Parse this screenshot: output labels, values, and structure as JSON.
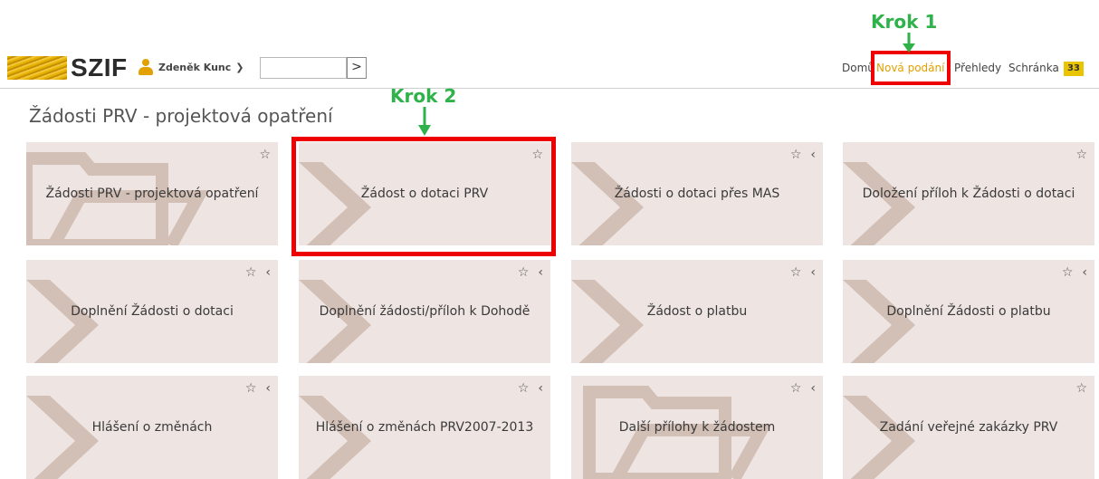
{
  "header": {
    "logo_text": "SZIF",
    "user_name": "Zdeněk Kunc",
    "search_value": "",
    "search_button": ">",
    "nav": [
      {
        "label": "Domů",
        "active": false
      },
      {
        "label": "Nová podání",
        "active": true
      },
      {
        "label": "Přehledy",
        "active": false
      },
      {
        "label": "Schránka",
        "active": false
      }
    ],
    "inbox_count": "33"
  },
  "annotations": {
    "step1": "Krok 1",
    "step2": "Krok 2"
  },
  "page": {
    "title": "Žádosti PRV - projektová opatření"
  },
  "tiles": [
    {
      "label": "Žádosti PRV - projektová opatření",
      "icon": "folder",
      "star": "☆",
      "collapse": ""
    },
    {
      "label": "Žádost o dotaci PRV",
      "icon": "chevron",
      "star": "☆",
      "collapse": ""
    },
    {
      "label": "Žádosti o dotaci přes MAS",
      "icon": "chevron",
      "star": "☆",
      "collapse": "‹"
    },
    {
      "label": "Doložení příloh k Žádosti o dotaci",
      "icon": "chevron",
      "star": "☆",
      "collapse": ""
    },
    {
      "label": "Doplnění Žádosti o dotaci",
      "icon": "chevron",
      "star": "☆",
      "collapse": "‹"
    },
    {
      "label": "Doplnění žádosti/příloh k Dohodě",
      "icon": "chevron",
      "star": "☆",
      "collapse": "‹"
    },
    {
      "label": "Žádost o platbu",
      "icon": "chevron",
      "star": "☆",
      "collapse": "‹"
    },
    {
      "label": "Doplnění Žádosti o platbu",
      "icon": "chevron",
      "star": "☆",
      "collapse": "‹"
    },
    {
      "label": "Hlášení o změnách",
      "icon": "chevron",
      "star": "☆",
      "collapse": "‹"
    },
    {
      "label": "Hlášení o změnách PRV2007-2013",
      "icon": "chevron",
      "star": "☆",
      "collapse": "‹"
    },
    {
      "label": "Další přílohy k žádostem",
      "icon": "folder",
      "star": "☆",
      "collapse": "‹"
    },
    {
      "label": "Zadání veřejné zakázky PRV",
      "icon": "chevron",
      "star": "☆",
      "collapse": ""
    }
  ],
  "colors": {
    "tile_bg": "#eee5e2",
    "tile_decoration": "#d2bfb6",
    "highlight": "#ef0000",
    "annotation": "#2fb24a",
    "active_nav": "#e0a000",
    "badge": "#e9c400"
  }
}
